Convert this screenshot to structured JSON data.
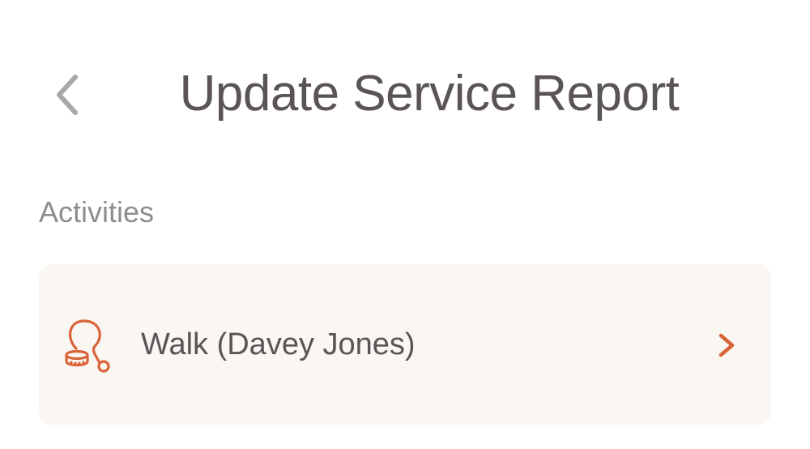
{
  "header": {
    "title": "Update Service Report",
    "back_icon": "chevron-left-icon"
  },
  "activities": {
    "section_label": "Activities",
    "items": [
      {
        "label": "Walk (Davey Jones)",
        "icon": "leash-icon",
        "trailing_icon": "chevron-right-icon"
      }
    ]
  },
  "colors": {
    "title_text": "#5a5457",
    "label_text": "#8f8d8e",
    "card_background": "#faf6f2",
    "accent": "#d9643a",
    "back_icon": "#a9a7a8"
  }
}
